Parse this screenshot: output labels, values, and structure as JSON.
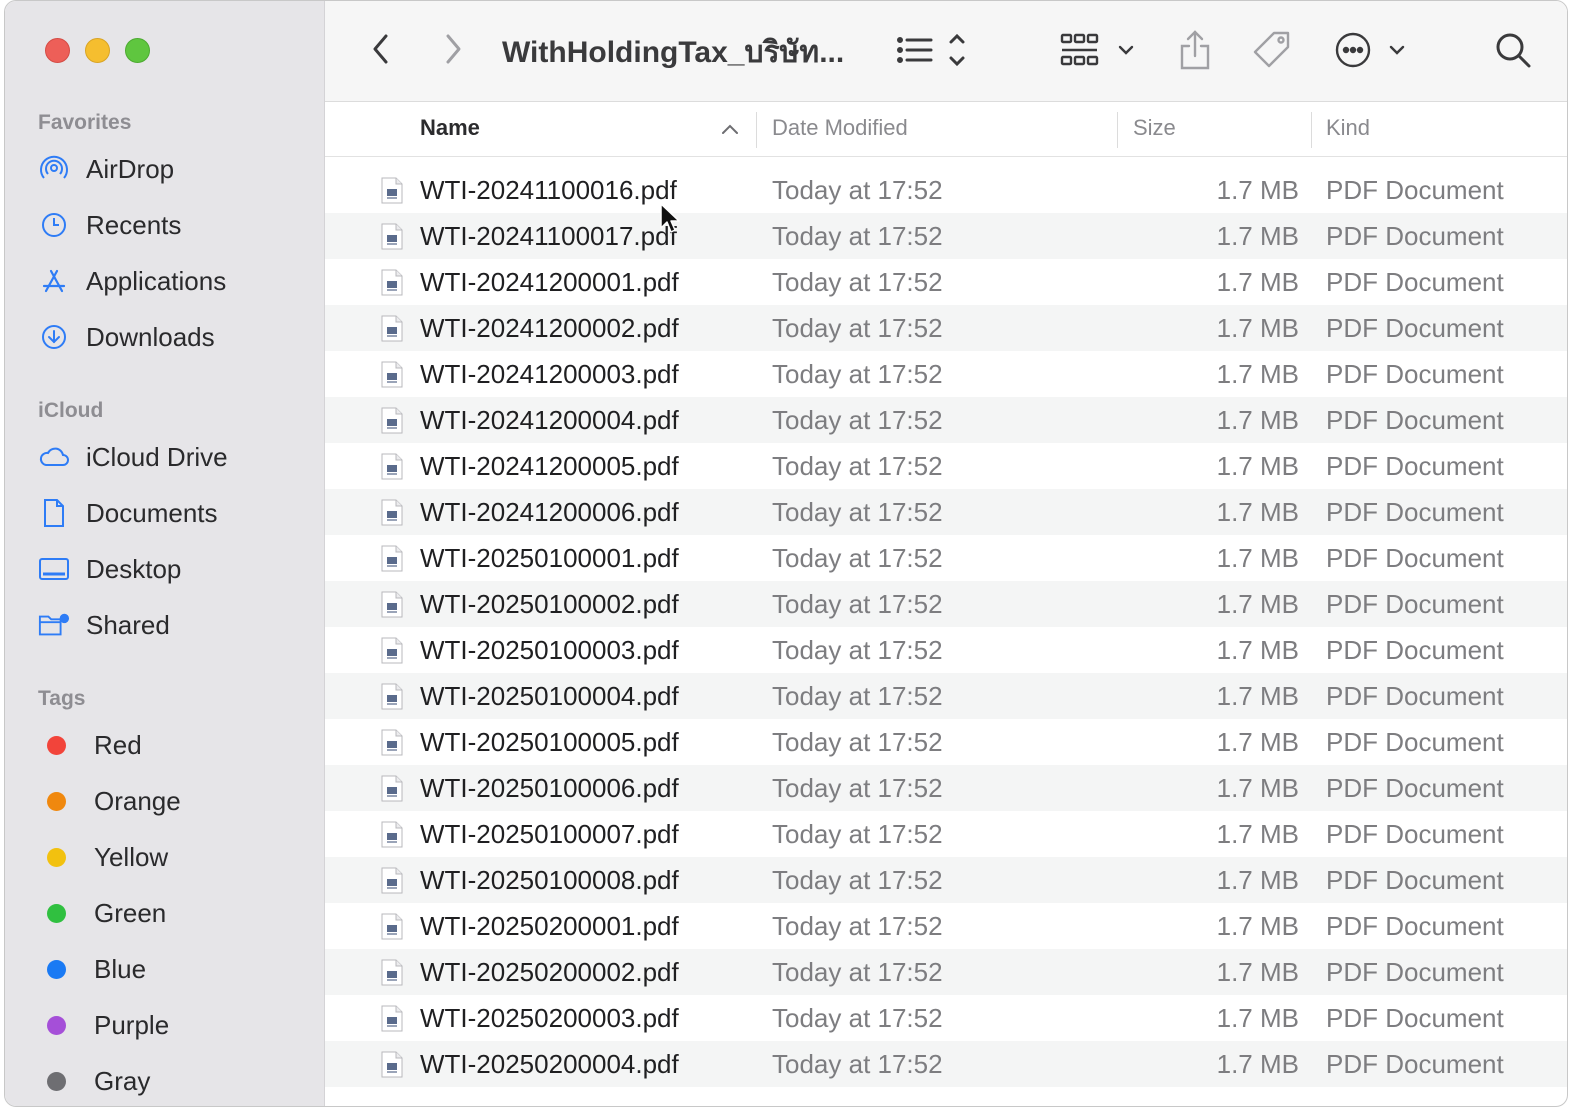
{
  "window": {
    "title": "WithHoldingTax_บริษัท...",
    "accent_color": "#2e7cf6"
  },
  "sidebar": {
    "favorites_title": "Favorites",
    "favorites": [
      {
        "label": "AirDrop",
        "icon": "airdrop-icon"
      },
      {
        "label": "Recents",
        "icon": "clock-icon"
      },
      {
        "label": "Applications",
        "icon": "applications-icon"
      },
      {
        "label": "Downloads",
        "icon": "download-icon"
      }
    ],
    "icloud_title": "iCloud",
    "icloud": [
      {
        "label": "iCloud Drive",
        "icon": "cloud-icon"
      },
      {
        "label": "Documents",
        "icon": "document-icon"
      },
      {
        "label": "Desktop",
        "icon": "desktop-icon"
      },
      {
        "label": "Shared",
        "icon": "shared-folder-icon"
      }
    ],
    "tags_title": "Tags",
    "tags": [
      {
        "label": "Red",
        "color": "#f2443a"
      },
      {
        "label": "Orange",
        "color": "#f0880e"
      },
      {
        "label": "Yellow",
        "color": "#f2c10f"
      },
      {
        "label": "Green",
        "color": "#30c040"
      },
      {
        "label": "Blue",
        "color": "#1a7af4"
      },
      {
        "label": "Purple",
        "color": "#a54fd8"
      },
      {
        "label": "Gray",
        "color": "#6e6e72"
      }
    ]
  },
  "table": {
    "columns": {
      "name": "Name",
      "date": "Date Modified",
      "size": "Size",
      "kind": "Kind"
    },
    "rows": [
      {
        "name": "WTI-20241100016.pdf",
        "date": "Today at 17:52",
        "size": "1.7 MB",
        "kind": "PDF Document"
      },
      {
        "name": "WTI-20241100017.pdf",
        "date": "Today at 17:52",
        "size": "1.7 MB",
        "kind": "PDF Document"
      },
      {
        "name": "WTI-20241200001.pdf",
        "date": "Today at 17:52",
        "size": "1.7 MB",
        "kind": "PDF Document"
      },
      {
        "name": "WTI-20241200002.pdf",
        "date": "Today at 17:52",
        "size": "1.7 MB",
        "kind": "PDF Document"
      },
      {
        "name": "WTI-20241200003.pdf",
        "date": "Today at 17:52",
        "size": "1.7 MB",
        "kind": "PDF Document"
      },
      {
        "name": "WTI-20241200004.pdf",
        "date": "Today at 17:52",
        "size": "1.7 MB",
        "kind": "PDF Document"
      },
      {
        "name": "WTI-20241200005.pdf",
        "date": "Today at 17:52",
        "size": "1.7 MB",
        "kind": "PDF Document"
      },
      {
        "name": "WTI-20241200006.pdf",
        "date": "Today at 17:52",
        "size": "1.7 MB",
        "kind": "PDF Document"
      },
      {
        "name": "WTI-20250100001.pdf",
        "date": "Today at 17:52",
        "size": "1.7 MB",
        "kind": "PDF Document"
      },
      {
        "name": "WTI-20250100002.pdf",
        "date": "Today at 17:52",
        "size": "1.7 MB",
        "kind": "PDF Document"
      },
      {
        "name": "WTI-20250100003.pdf",
        "date": "Today at 17:52",
        "size": "1.7 MB",
        "kind": "PDF Document"
      },
      {
        "name": "WTI-20250100004.pdf",
        "date": "Today at 17:52",
        "size": "1.7 MB",
        "kind": "PDF Document"
      },
      {
        "name": "WTI-20250100005.pdf",
        "date": "Today at 17:52",
        "size": "1.7 MB",
        "kind": "PDF Document"
      },
      {
        "name": "WTI-20250100006.pdf",
        "date": "Today at 17:52",
        "size": "1.7 MB",
        "kind": "PDF Document"
      },
      {
        "name": "WTI-20250100007.pdf",
        "date": "Today at 17:52",
        "size": "1.7 MB",
        "kind": "PDF Document"
      },
      {
        "name": "WTI-20250100008.pdf",
        "date": "Today at 17:52",
        "size": "1.7 MB",
        "kind": "PDF Document"
      },
      {
        "name": "WTI-20250200001.pdf",
        "date": "Today at 17:52",
        "size": "1.7 MB",
        "kind": "PDF Document"
      },
      {
        "name": "WTI-20250200002.pdf",
        "date": "Today at 17:52",
        "size": "1.7 MB",
        "kind": "PDF Document"
      },
      {
        "name": "WTI-20250200003.pdf",
        "date": "Today at 17:52",
        "size": "1.7 MB",
        "kind": "PDF Document"
      },
      {
        "name": "WTI-20250200004.pdf",
        "date": "Today at 17:52",
        "size": "1.7 MB",
        "kind": "PDF Document"
      }
    ]
  }
}
